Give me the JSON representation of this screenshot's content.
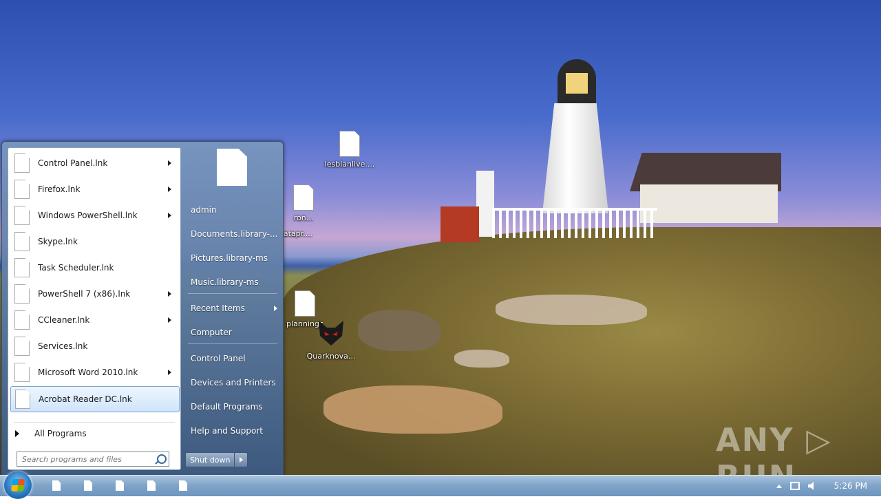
{
  "desktop": {
    "icons": [
      {
        "label": "lesbianlive...."
      },
      {
        "label": "ron..."
      },
      {
        "label": "atapr...."
      },
      {
        "label": "planningc"
      },
      {
        "label": "Quarknova..."
      }
    ],
    "watermark": "ANY ▷ RUN"
  },
  "start_menu": {
    "programs": [
      {
        "label": "Control Panel.lnk",
        "has_submenu": true
      },
      {
        "label": "Firefox.lnk",
        "has_submenu": true
      },
      {
        "label": "Windows PowerShell.lnk",
        "has_submenu": true
      },
      {
        "label": "Skype.lnk",
        "has_submenu": false
      },
      {
        "label": "Task Scheduler.lnk",
        "has_submenu": false
      },
      {
        "label": "PowerShell 7 (x86).lnk",
        "has_submenu": true
      },
      {
        "label": "CCleaner.lnk",
        "has_submenu": true
      },
      {
        "label": "Services.lnk",
        "has_submenu": false
      },
      {
        "label": "Microsoft Word 2010.lnk",
        "has_submenu": true
      },
      {
        "label": "Acrobat Reader DC.lnk",
        "has_submenu": false,
        "highlighted": true
      }
    ],
    "all_programs": "All Programs",
    "search_placeholder": "Search programs and files",
    "right_items": [
      {
        "label": "admin"
      },
      {
        "label": "Documents.library-..."
      },
      {
        "label": "Pictures.library-ms"
      },
      {
        "label": "Music.library-ms"
      },
      {
        "label": "Recent Items",
        "has_submenu": true
      },
      {
        "label": "Computer"
      },
      {
        "label": "Control Panel"
      },
      {
        "label": "Devices and Printers"
      },
      {
        "label": "Default Programs"
      },
      {
        "label": "Help and Support"
      }
    ],
    "shutdown_label": "Shut down"
  },
  "taskbar": {
    "clock": "5:26 PM",
    "pinned_count": 5
  }
}
